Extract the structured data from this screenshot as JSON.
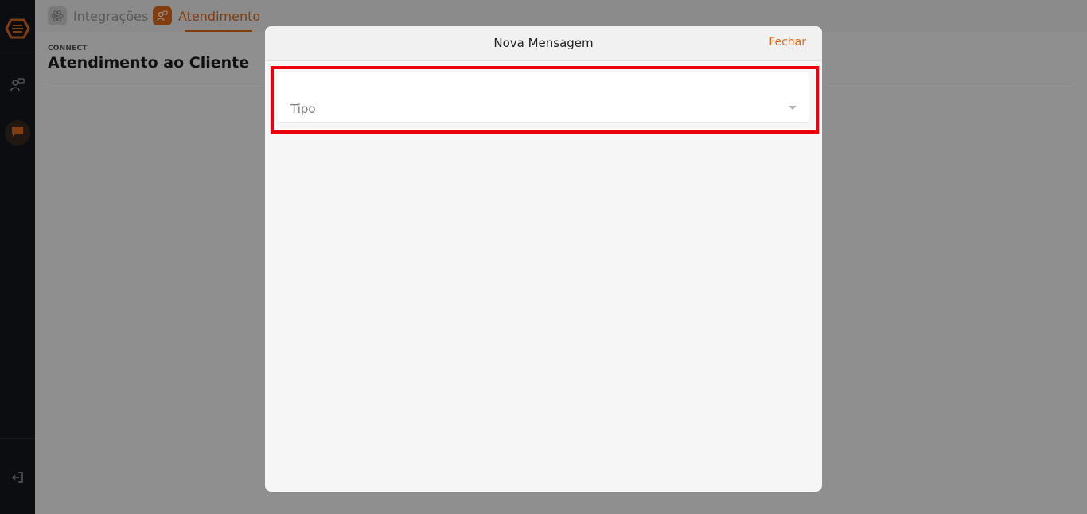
{
  "tabs": [
    {
      "label": "Integrações",
      "icon": "atom-icon",
      "active": false
    },
    {
      "label": "Atendimento",
      "icon": "support-agent-icon",
      "active": true
    }
  ],
  "page": {
    "kicker": "CONNECT",
    "title": "Atendimento ao Cliente"
  },
  "sidebar": {
    "items": [
      {
        "icon": "support-agent-icon"
      },
      {
        "icon": "chat-icon"
      }
    ],
    "logout_icon": "logout-icon"
  },
  "modal": {
    "title": "Nova Mensagem",
    "close_label": "Fechar",
    "field": {
      "label": "Tipo",
      "value": ""
    }
  },
  "colors": {
    "accent": "#e06a1a",
    "sidebar": "#14171c",
    "highlight": "#e8000a"
  }
}
